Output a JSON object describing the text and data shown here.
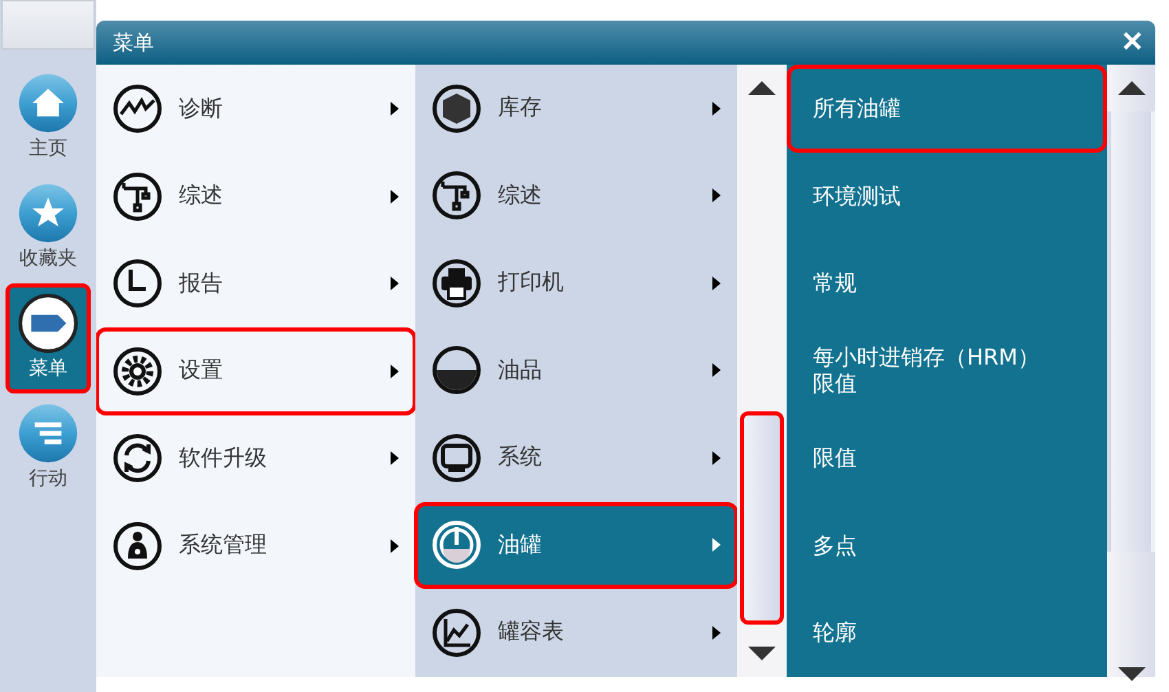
{
  "sidebar": {
    "items": [
      {
        "label": "主页",
        "selected": false,
        "highlighted": false
      },
      {
        "label": "收藏夹",
        "selected": false,
        "highlighted": false
      },
      {
        "label": "菜单",
        "selected": true,
        "highlighted": true
      },
      {
        "label": "行动",
        "selected": false,
        "highlighted": false
      }
    ]
  },
  "menu": {
    "title": "菜单",
    "close": "✕",
    "column_1": [
      {
        "label": "诊断",
        "highlighted": false
      },
      {
        "label": "综述",
        "highlighted": false
      },
      {
        "label": "报告",
        "highlighted": false
      },
      {
        "label": "设置",
        "highlighted": true
      },
      {
        "label": "软件升级",
        "highlighted": false
      },
      {
        "label": "系统管理",
        "highlighted": false
      }
    ],
    "column_2": [
      {
        "label": "库存",
        "selected": false,
        "highlighted": false
      },
      {
        "label": "综述",
        "selected": false,
        "highlighted": false
      },
      {
        "label": "打印机",
        "selected": false,
        "highlighted": false
      },
      {
        "label": "油品",
        "selected": false,
        "highlighted": false
      },
      {
        "label": "系统",
        "selected": false,
        "highlighted": false
      },
      {
        "label": "油罐",
        "selected": true,
        "highlighted": true
      },
      {
        "label": "罐容表",
        "selected": false,
        "highlighted": false
      }
    ],
    "column_2_scrollbar": {
      "highlighted": true
    },
    "column_3": [
      {
        "label": "所有油罐",
        "highlighted": true
      },
      {
        "label": "环境测试",
        "highlighted": false
      },
      {
        "label": "常规",
        "highlighted": false
      },
      {
        "label": "每小时进销存（HRM）限值",
        "highlighted": false
      },
      {
        "label": "限值",
        "highlighted": false
      },
      {
        "label": "多点",
        "highlighted": false
      },
      {
        "label": "轮廓",
        "highlighted": false
      }
    ],
    "column_3_scrollbar": {
      "highlighted": false
    }
  }
}
